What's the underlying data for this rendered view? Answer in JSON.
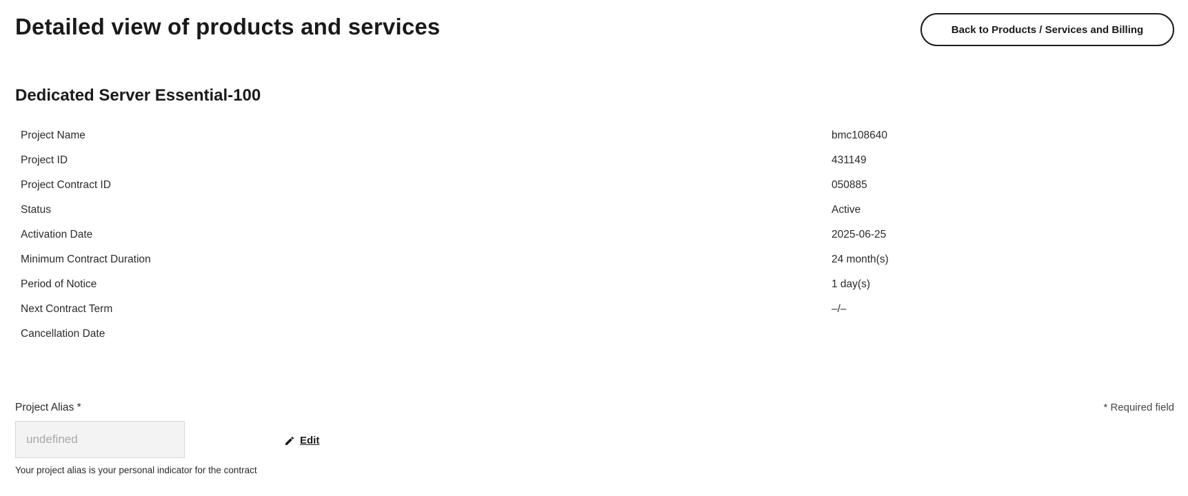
{
  "header": {
    "title": "Detailed view of products and services",
    "back_button_label": "Back to Products / Services and Billing"
  },
  "product": {
    "title": "Dedicated Server Essential-100",
    "details": [
      {
        "label": "Project Name",
        "value": "bmc108640"
      },
      {
        "label": "Project ID",
        "value": "431149"
      },
      {
        "label": "Project Contract ID",
        "value": "050885"
      },
      {
        "label": "Status",
        "value": "Active"
      },
      {
        "label": "Activation Date",
        "value": "2025-06-25"
      },
      {
        "label": "Minimum Contract Duration",
        "value": "24 month(s)"
      },
      {
        "label": "Period of Notice",
        "value": "1 day(s)"
      },
      {
        "label": "Next Contract Term",
        "value": "–/–"
      },
      {
        "label": "Cancellation Date",
        "value": ""
      }
    ]
  },
  "alias": {
    "label": "Project Alias *",
    "required_note": "* Required field",
    "input_placeholder": "undefined",
    "edit_label": "Edit",
    "edit_icon": "pencil-icon",
    "hint": "Your project alias is your personal indicator for the contract"
  }
}
